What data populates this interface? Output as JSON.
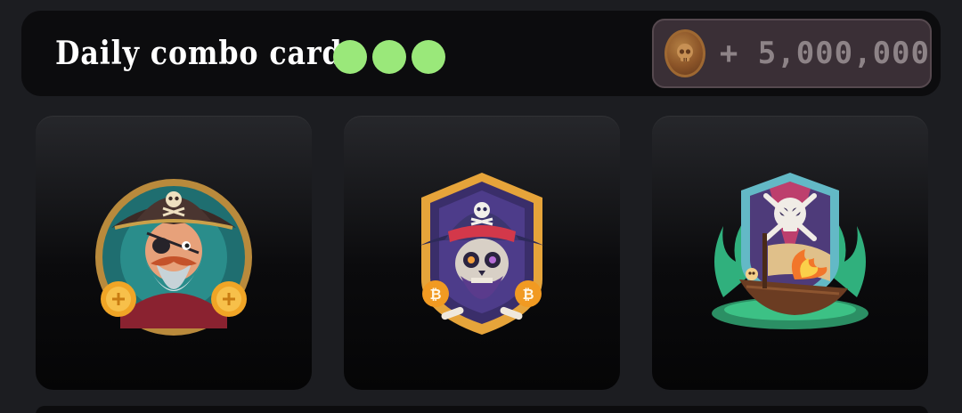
{
  "header": {
    "title": "Daily combo card",
    "progress_dots": [
      {
        "state": "filled",
        "color": "#9ae87a"
      },
      {
        "state": "filled",
        "color": "#9ae87a"
      },
      {
        "state": "filled",
        "color": "#9ae87a"
      }
    ],
    "reward": {
      "icon": "skull-coin-icon",
      "text": "+ 5,000,000"
    }
  },
  "cards": [
    {
      "icon": "pirate-captain-icon"
    },
    {
      "icon": "skeleton-pirate-bitcoin-icon"
    },
    {
      "icon": "pirate-ship-skull-icon"
    }
  ],
  "colors": {
    "background": "#1c1d21",
    "header_bg": "#0c0c0e",
    "dot_green": "#9ae87a",
    "reward_bg": "#3a2f36",
    "reward_text": "#8d8387"
  }
}
